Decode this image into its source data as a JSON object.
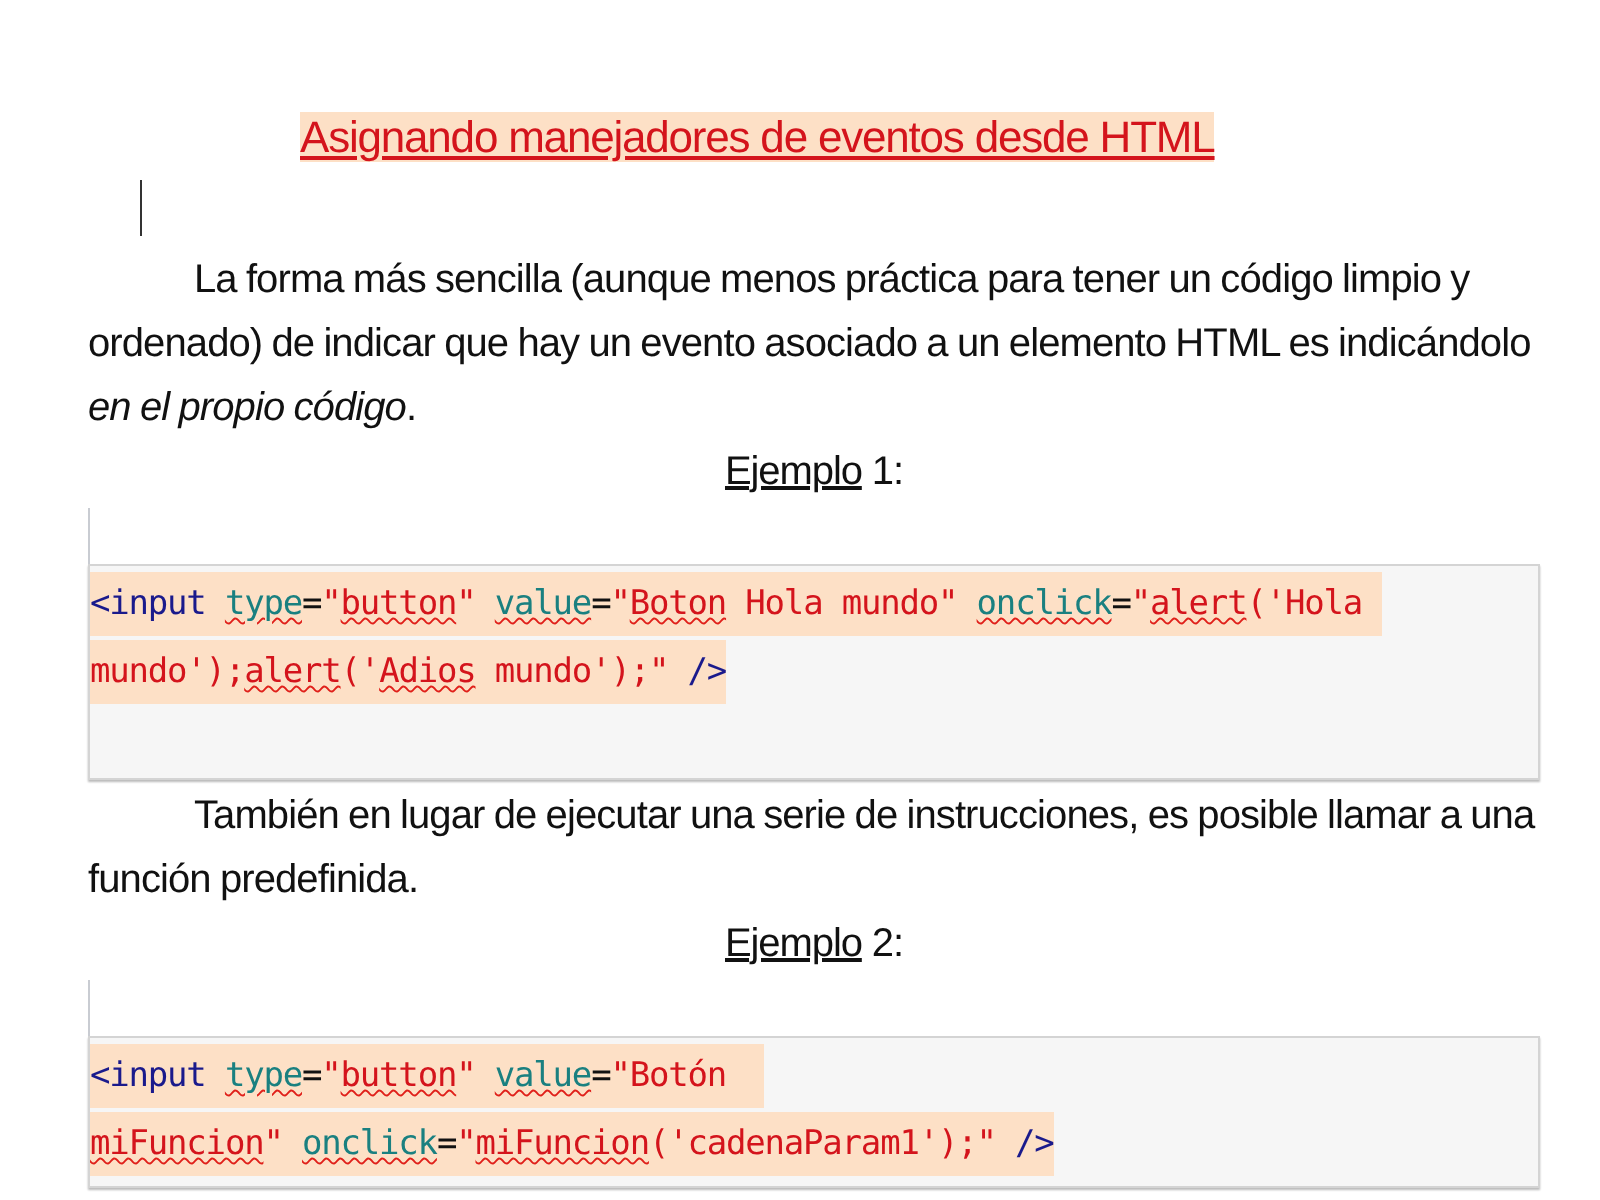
{
  "document": {
    "title": "Asignando manejadores de eventos desde HTML ",
    "blocks": [
      {
        "kind": "paragraph",
        "text": "La forma más sencilla (aunque menos práctica para tener un código limpio y ordenado) de indicar que hay un evento asociado a un elemento HTML es indicándolo *en el propio código*."
      },
      {
        "kind": "caption",
        "underlined": "Ejemplo",
        "text": " 1:"
      },
      {
        "kind": "code",
        "lines": [
          [
            {
              "text": "<input ",
              "kind": "tag",
              "misspelled": false
            },
            {
              "text": "type",
              "kind": "attr",
              "misspelled": true
            },
            {
              "text": "=",
              "kind": "punct",
              "misspelled": false
            },
            {
              "text": "\"",
              "kind": "string",
              "misspelled": false
            },
            {
              "text": "button",
              "kind": "string",
              "misspelled": true
            },
            {
              "text": "\" ",
              "kind": "string",
              "misspelled": false
            },
            {
              "text": "value",
              "kind": "attr",
              "misspelled": true
            },
            {
              "text": "=",
              "kind": "punct",
              "misspelled": false
            },
            {
              "text": "\"",
              "kind": "string",
              "misspelled": false
            },
            {
              "text": "Boton",
              "kind": "string",
              "misspelled": true
            },
            {
              "text": " Hola mundo\" ",
              "kind": "string",
              "misspelled": false
            },
            {
              "text": "onclick",
              "kind": "attr",
              "misspelled": true
            },
            {
              "text": "=",
              "kind": "punct",
              "misspelled": false
            },
            {
              "text": "\"",
              "kind": "string",
              "misspelled": false
            },
            {
              "text": "alert",
              "kind": "string",
              "misspelled": true
            },
            {
              "text": "('Hola ",
              "kind": "string",
              "misspelled": false
            }
          ],
          [
            {
              "text": "mundo');",
              "kind": "string",
              "misspelled": false
            },
            {
              "text": "alert",
              "kind": "string",
              "misspelled": true
            },
            {
              "text": "('",
              "kind": "string",
              "misspelled": false
            },
            {
              "text": "Adios",
              "kind": "string",
              "misspelled": true
            },
            {
              "text": " mundo');\" ",
              "kind": "string",
              "misspelled": false
            },
            {
              "text": "/>",
              "kind": "tag",
              "misspelled": false
            }
          ]
        ]
      },
      {
        "kind": "paragraph",
        "text": "También en lugar de ejecutar una serie de instrucciones, es posible llamar a una función predefinida."
      },
      {
        "kind": "caption",
        "underlined": "Ejemplo",
        "text": " 2:"
      },
      {
        "kind": "code",
        "lines": [
          [
            {
              "text": "<input ",
              "kind": "tag",
              "misspelled": false
            },
            {
              "text": "type",
              "kind": "attr",
              "misspelled": true
            },
            {
              "text": "=",
              "kind": "punct",
              "misspelled": false
            },
            {
              "text": "\"",
              "kind": "string",
              "misspelled": false
            },
            {
              "text": "button",
              "kind": "string",
              "misspelled": true
            },
            {
              "text": "\" ",
              "kind": "string",
              "misspelled": false
            },
            {
              "text": "value",
              "kind": "attr",
              "misspelled": true
            },
            {
              "text": "=",
              "kind": "punct",
              "misspelled": false
            },
            {
              "text": "\"Botón  ",
              "kind": "string",
              "misspelled": false
            }
          ],
          [
            {
              "text": "miFuncion",
              "kind": "string",
              "misspelled": true
            },
            {
              "text": "\" ",
              "kind": "string",
              "misspelled": false
            },
            {
              "text": "onclick",
              "kind": "attr",
              "misspelled": true
            },
            {
              "text": "=",
              "kind": "punct",
              "misspelled": false
            },
            {
              "text": "\"",
              "kind": "string",
              "misspelled": false
            },
            {
              "text": "miFuncion",
              "kind": "string",
              "misspelled": true
            },
            {
              "text": "('cadenaParam1');\" ",
              "kind": "string",
              "misspelled": false
            },
            {
              "text": "/>",
              "kind": "tag",
              "misspelled": false
            }
          ]
        ]
      }
    ]
  }
}
